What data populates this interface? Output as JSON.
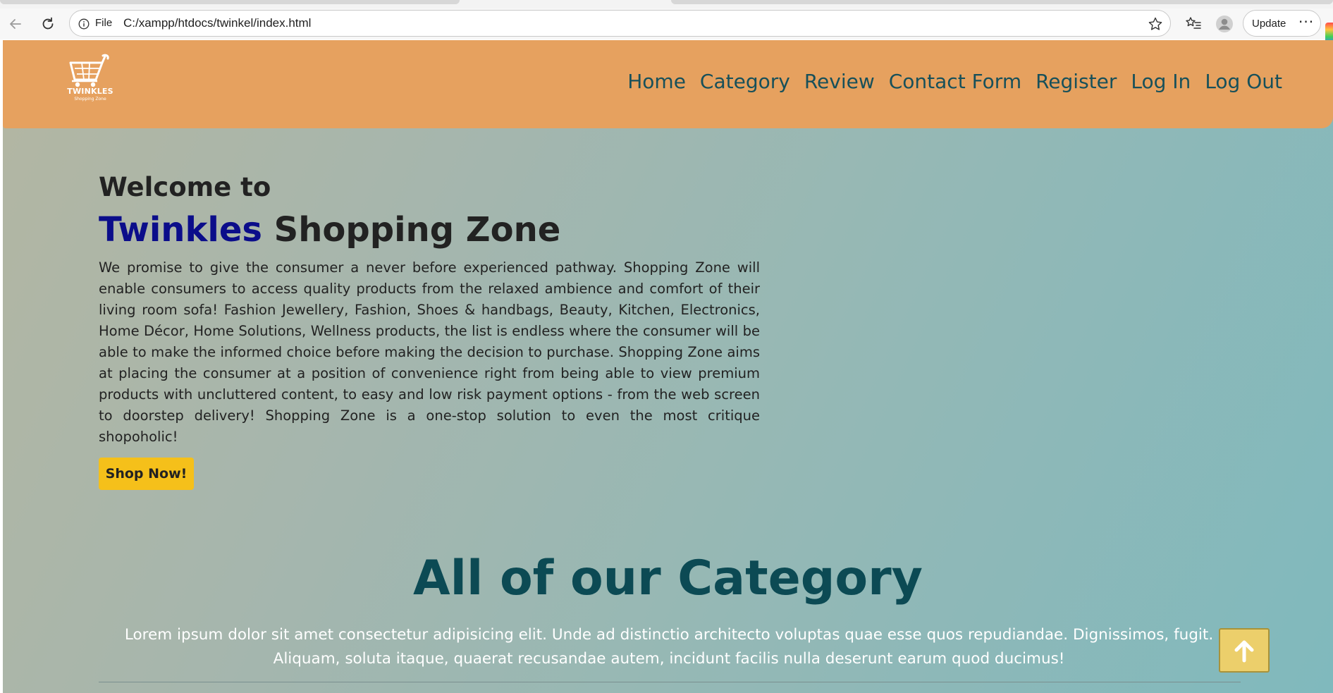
{
  "browser": {
    "scheme_label": "File",
    "url": "C:/xampp/htdocs/twinkel/index.html",
    "update_label": "Update",
    "more_label": "···"
  },
  "site": {
    "logo": {
      "brand": "TWINKLES",
      "tagline": "Shopping Zone"
    },
    "nav": [
      "Home",
      "Category",
      "Review",
      "Contact Form",
      "Register",
      "Log In",
      "Log Out"
    ],
    "hero": {
      "welcome": "Welcome to",
      "title_accent": "Twinkles",
      "title_rest": "Shopping Zone",
      "description": "We promise to give the consumer a never before experienced pathway. Shopping Zone will enable consumers to access quality products from the relaxed ambience and comfort of their living room sofa! Fashion Jewellery, Fashion, Shoes & handbags, Beauty, Kitchen, Electronics, Home Décor, Home Solutions, Wellness products, the list is endless where the consumer will be able to make the informed choice before making the decision to purchase. Shopping Zone aims at placing the consumer at a position of convenience right from being able to view premium products with uncluttered content, to easy and low risk payment options - from the web screen to doorstep delivery! Shopping Zone is a one-stop solution to even the most critique shopoholic!",
      "cta_label": "Shop Now!"
    },
    "category": {
      "title": "All of our Category",
      "description": "Lorem ipsum dolor sit amet consectetur adipisicing elit. Unde ad distinctio architecto voluptas quae esse quos repudiandae. Dignissimos, fugit. Aliquam, soluta itaque, quaerat recusandae autem, incidunt facilis nulla deserunt earum quod ducimus!"
    }
  },
  "colors": {
    "header_bg": "#e6a15f",
    "nav_text": "#17505a",
    "brand_accent": "#0b0d8a",
    "cta_bg": "#f5c01a",
    "category_title": "#0c4a54",
    "to_top_bg": "#eccf6b"
  },
  "icons": {
    "back": "arrow-left-icon",
    "reload": "reload-icon",
    "info": "info-icon",
    "star": "star-icon",
    "favorites": "favorites-icon",
    "profile": "profile-icon",
    "cart": "shopping-cart-icon",
    "to_top": "arrow-up-icon"
  }
}
